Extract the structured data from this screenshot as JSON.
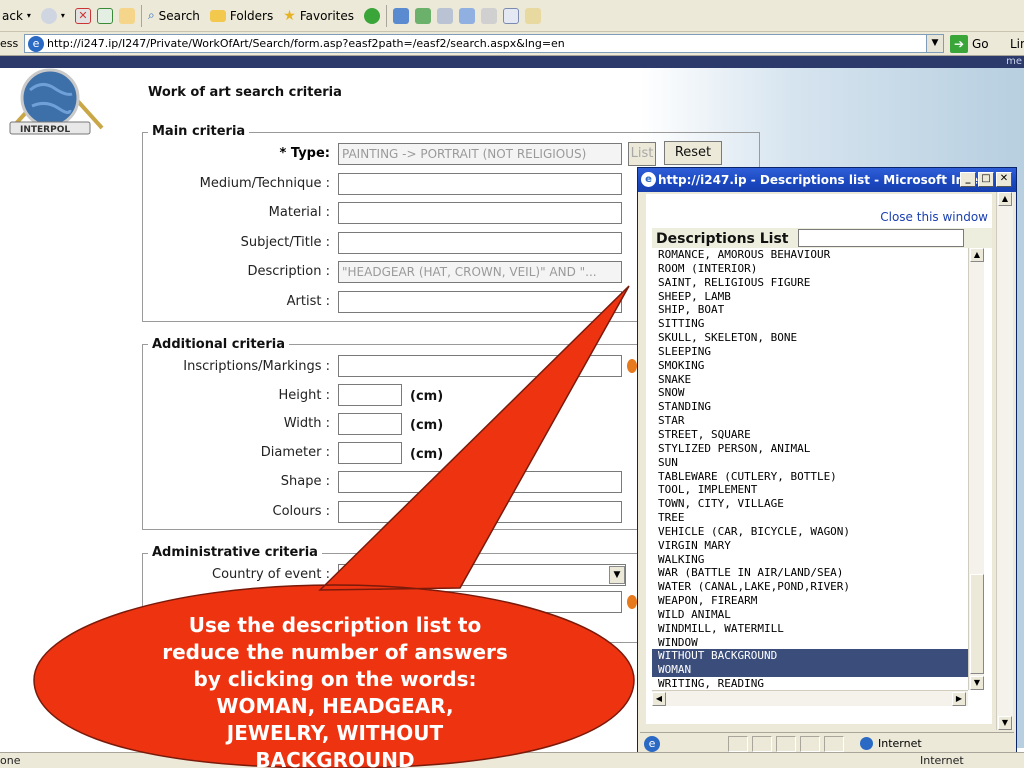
{
  "browser": {
    "toolbar": {
      "back": "ack",
      "search": "Search",
      "folders": "Folders",
      "favorites": "Favorites"
    },
    "address": {
      "label": "ess",
      "url": "http://i247.ip/I247/Private/WorkOfArt/Search/form.asp?easf2path=/easf2/search.aspx&lng=en",
      "go": "Go",
      "links": "Lin"
    },
    "header_right": "me",
    "status": "one",
    "status_zone": "Internet"
  },
  "page": {
    "title": "Work of art search criteria",
    "main": {
      "legend": "Main criteria",
      "type_label": "* Type:",
      "type_value": "PAINTING -> PORTRAIT (NOT RELIGIOUS)",
      "list_button": "List",
      "reset_button": "Reset",
      "medium_label": "Medium/Technique :",
      "material_label": "Material :",
      "subject_label": "Subject/Title :",
      "description_label": "Description :",
      "description_value": "\"HEADGEAR (HAT, CROWN, VEIL)\" AND \"...",
      "artist_label": "Artist :"
    },
    "additional": {
      "legend": "Additional criteria",
      "inscriptions_label": "Inscriptions/Markings :",
      "height_label": "Height :",
      "width_label": "Width :",
      "diameter_label": "Diameter :",
      "unit": "(cm)",
      "shape_label": "Shape :",
      "colours_label": "Colours :"
    },
    "administrative": {
      "legend": "Administrative criteria",
      "country_label": "Country of event :",
      "country_value": "A"
    }
  },
  "popup": {
    "title": "http://i247.ip - Descriptions list - Microsoft Inte...",
    "close_link": "Close this window",
    "list_heading": "Descriptions List",
    "items": [
      "ROMANCE, AMOROUS BEHAVIOUR",
      "ROOM (INTERIOR)",
      "SAINT, RELIGIOUS FIGURE",
      "SHEEP, LAMB",
      "SHIP, BOAT",
      "SITTING",
      "SKULL, SKELETON, BONE",
      "SLEEPING",
      "SMOKING",
      "SNAKE",
      "SNOW",
      "STANDING",
      "STAR",
      "STREET, SQUARE",
      "STYLIZED PERSON, ANIMAL",
      "SUN",
      "TABLEWARE (CUTLERY, BOTTLE)",
      "TOOL, IMPLEMENT",
      "TOWN, CITY, VILLAGE",
      "TREE",
      "VEHICLE (CAR, BICYCLE, WAGON)",
      "VIRGIN MARY",
      "WALKING",
      "WAR (BATTLE IN AIR/LAND/SEA)",
      "WATER (CANAL,LAKE,POND,RIVER)",
      "WEAPON, FIREARM",
      "WILD ANIMAL",
      "WINDMILL, WATERMILL",
      "WINDOW",
      "WITHOUT BACKGROUND",
      "WOMAN",
      "WRITING, READING"
    ],
    "selected": [
      "WITHOUT BACKGROUND",
      "WOMAN"
    ],
    "status_zone": "Internet"
  },
  "callout": {
    "lines": [
      "Use the description list to",
      "reduce the number of answers",
      "by clicking on the words:",
      "WOMAN, HEADGEAR,",
      "JEWELRY, WITHOUT",
      "BACKGROUND"
    ],
    "color": "#ee3311"
  }
}
